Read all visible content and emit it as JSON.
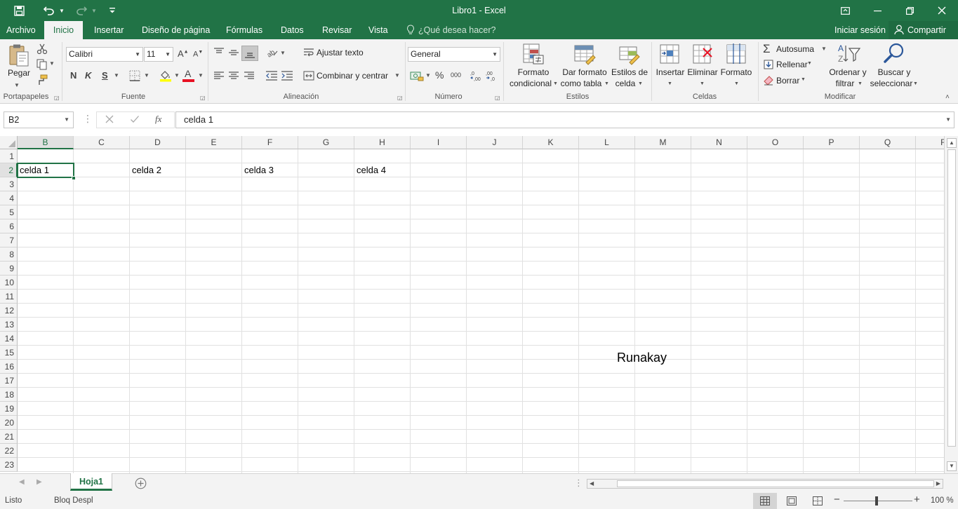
{
  "window": {
    "title": "Libro1 - Excel"
  },
  "tabs": [
    "Archivo",
    "Inicio",
    "Insertar",
    "Diseño de página",
    "Fórmulas",
    "Datos",
    "Revisar",
    "Vista"
  ],
  "tell_me": "¿Qué desea hacer?",
  "account": {
    "sign_in": "Iniciar sesión",
    "share": "Compartir"
  },
  "ribbon": {
    "clipboard": {
      "paste": "Pegar",
      "label": "Portapapeles"
    },
    "font": {
      "name": "Calibri",
      "size": "11",
      "bold": "N",
      "italic": "K",
      "underline": "S",
      "font_color_letter": "A",
      "label": "Fuente"
    },
    "alignment": {
      "wrap": "Ajustar texto",
      "merge": "Combinar y centrar",
      "label": "Alineación"
    },
    "number": {
      "format": "General",
      "percent": "%",
      "thousands": "000",
      "label": "Número"
    },
    "styles": {
      "conditional_1": "Formato",
      "conditional_2": "condicional",
      "table_1": "Dar formato",
      "table_2": "como tabla",
      "cellstyles_1": "Estilos de",
      "cellstyles_2": "celda",
      "label": "Estilos"
    },
    "cells": {
      "insert": "Insertar",
      "delete": "Eliminar",
      "format": "Formato",
      "label": "Celdas"
    },
    "editing": {
      "autosum": "Autosuma",
      "fill": "Rellenar",
      "clear": "Borrar",
      "sort_1": "Ordenar y",
      "sort_2": "filtrar",
      "find_1": "Buscar y",
      "find_2": "seleccionar",
      "label": "Modificar"
    }
  },
  "formula_bar": {
    "name_box": "B2",
    "fx": "fx",
    "content": "celda 1"
  },
  "columns": [
    "B",
    "C",
    "D",
    "E",
    "F",
    "G",
    "H",
    "I",
    "J",
    "K",
    "L",
    "M",
    "N",
    "O",
    "P",
    "Q",
    "R"
  ],
  "selected_column": "B",
  "rows": [
    "1",
    "2",
    "3",
    "4",
    "5",
    "6",
    "7",
    "8",
    "9",
    "10",
    "11",
    "12",
    "13",
    "14",
    "15",
    "16",
    "17",
    "18",
    "19",
    "20",
    "21",
    "22",
    "23"
  ],
  "selected_row": "2",
  "cells": {
    "B2": "celda 1",
    "D2": "celda 2",
    "F2": "celda 3",
    "H2": "celda 4"
  },
  "overlay_text": "Runakay",
  "sheets": {
    "active": "Hoja1"
  },
  "status": {
    "ready": "Listo",
    "scroll_lock": "Bloq Despl",
    "zoom": "100 %"
  }
}
